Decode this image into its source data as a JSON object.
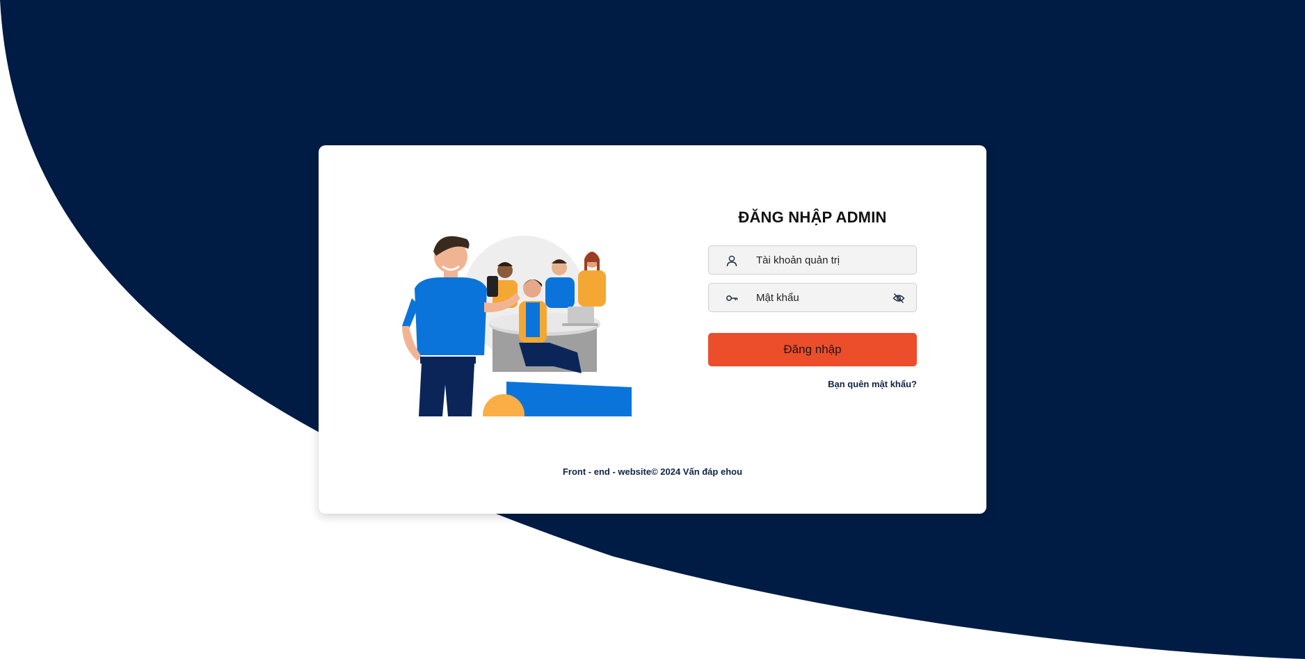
{
  "login": {
    "title": "ĐĂNG NHẬP ADMIN",
    "username_placeholder": "Tài khoản quản trị",
    "password_placeholder": "Mật khẩu",
    "submit_label": "Đăng nhập",
    "forgot_label": "Bạn quên mật khẩu?"
  },
  "footer": {
    "text": "Front - end - website© 2024 Vấn đáp ehou"
  },
  "icons": {
    "username": "user-icon",
    "password": "key-icon",
    "toggle": "eye-off-icon"
  },
  "colors": {
    "background_dark": "#001c44",
    "button": "#ec4d2b",
    "card": "#ffffff",
    "link": "#0f2447"
  }
}
